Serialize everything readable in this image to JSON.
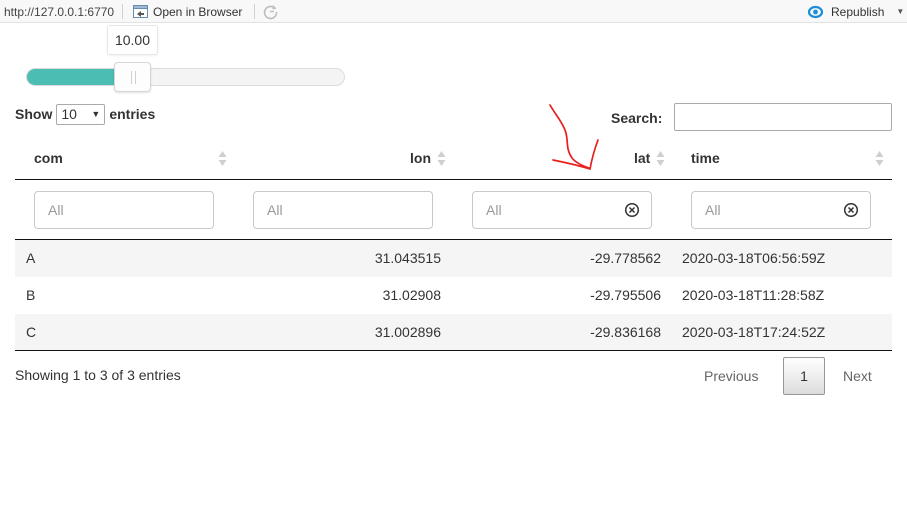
{
  "toolbar": {
    "url": "http://127.0.0.1:6770",
    "open_in_browser": "Open in Browser",
    "republish": "Republish",
    "accent_color": "#1a8fd6"
  },
  "slider": {
    "value_label": "10.00",
    "fill_fraction": 0.3,
    "fill_color": "#4bbdb2"
  },
  "table_controls": {
    "show_label": "Show",
    "page_length": "10",
    "entries_label": "entries",
    "search_label": "Search:",
    "search_value": ""
  },
  "table": {
    "columns": [
      {
        "label": "com"
      },
      {
        "label": "lon"
      },
      {
        "label": "lat"
      },
      {
        "label": "time"
      }
    ],
    "filter_placeholder": "All",
    "rows": [
      {
        "com": "A",
        "lon": "31.043515",
        "lat": "-29.778562",
        "time": "2020-03-18T06:56:59Z"
      },
      {
        "com": "B",
        "lon": "31.02908",
        "lat": "-29.795506",
        "time": "2020-03-18T11:28:58Z"
      },
      {
        "com": "C",
        "lon": "31.002896",
        "lat": "-29.836168",
        "time": "2020-03-18T17:24:52Z"
      }
    ]
  },
  "footer": {
    "info": "Showing 1 to 3 of 3 entries",
    "previous": "Previous",
    "current_page": "1",
    "next": "Next"
  },
  "annotation": {
    "shape": "hand-drawn arrow pointing at lat column",
    "color": "#e8201c"
  }
}
